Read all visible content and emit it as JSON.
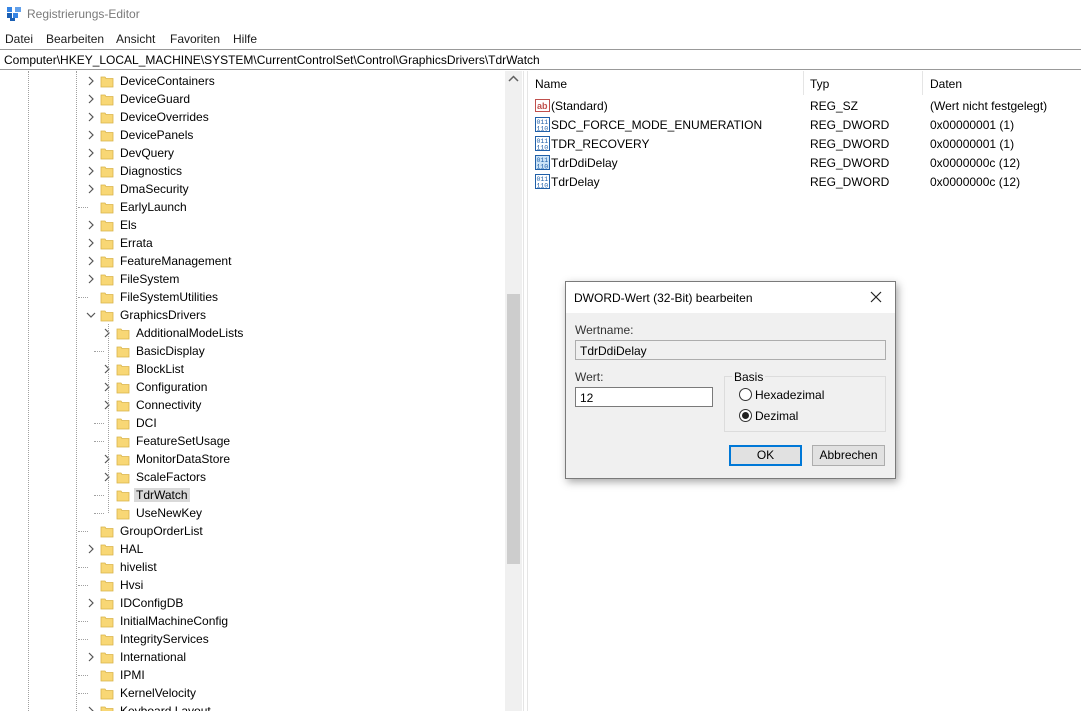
{
  "window": {
    "title": "Registrierungs-Editor"
  },
  "menu": [
    "Datei",
    "Bearbeiten",
    "Ansicht",
    "Favoriten",
    "Hilfe"
  ],
  "address": "Computer\\HKEY_LOCAL_MACHINE\\SYSTEM\\CurrentControlSet\\Control\\GraphicsDrivers\\TdrWatch",
  "tree": [
    {
      "label": "DeviceContainers",
      "level": 0,
      "expander": "collapsed"
    },
    {
      "label": "DeviceGuard",
      "level": 0,
      "expander": "collapsed"
    },
    {
      "label": "DeviceOverrides",
      "level": 0,
      "expander": "collapsed"
    },
    {
      "label": "DevicePanels",
      "level": 0,
      "expander": "collapsed"
    },
    {
      "label": "DevQuery",
      "level": 0,
      "expander": "collapsed"
    },
    {
      "label": "Diagnostics",
      "level": 0,
      "expander": "collapsed"
    },
    {
      "label": "DmaSecurity",
      "level": 0,
      "expander": "collapsed"
    },
    {
      "label": "EarlyLaunch",
      "level": 0,
      "expander": "none"
    },
    {
      "label": "Els",
      "level": 0,
      "expander": "collapsed"
    },
    {
      "label": "Errata",
      "level": 0,
      "expander": "collapsed"
    },
    {
      "label": "FeatureManagement",
      "level": 0,
      "expander": "collapsed"
    },
    {
      "label": "FileSystem",
      "level": 0,
      "expander": "collapsed"
    },
    {
      "label": "FileSystemUtilities",
      "level": 0,
      "expander": "none"
    },
    {
      "label": "GraphicsDrivers",
      "level": 0,
      "expander": "expanded"
    },
    {
      "label": "AdditionalModeLists",
      "level": 1,
      "expander": "collapsed"
    },
    {
      "label": "BasicDisplay",
      "level": 1,
      "expander": "none"
    },
    {
      "label": "BlockList",
      "level": 1,
      "expander": "collapsed"
    },
    {
      "label": "Configuration",
      "level": 1,
      "expander": "collapsed"
    },
    {
      "label": "Connectivity",
      "level": 1,
      "expander": "collapsed"
    },
    {
      "label": "DCI",
      "level": 1,
      "expander": "none"
    },
    {
      "label": "FeatureSetUsage",
      "level": 1,
      "expander": "none"
    },
    {
      "label": "MonitorDataStore",
      "level": 1,
      "expander": "collapsed"
    },
    {
      "label": "ScaleFactors",
      "level": 1,
      "expander": "collapsed"
    },
    {
      "label": "TdrWatch",
      "level": 1,
      "expander": "none",
      "selected": true
    },
    {
      "label": "UseNewKey",
      "level": 1,
      "expander": "none"
    },
    {
      "label": "GroupOrderList",
      "level": 0,
      "expander": "none"
    },
    {
      "label": "HAL",
      "level": 0,
      "expander": "collapsed"
    },
    {
      "label": "hivelist",
      "level": 0,
      "expander": "none"
    },
    {
      "label": "Hvsi",
      "level": 0,
      "expander": "none"
    },
    {
      "label": "IDConfigDB",
      "level": 0,
      "expander": "collapsed"
    },
    {
      "label": "InitialMachineConfig",
      "level": 0,
      "expander": "none"
    },
    {
      "label": "IntegrityServices",
      "level": 0,
      "expander": "none"
    },
    {
      "label": "International",
      "level": 0,
      "expander": "collapsed"
    },
    {
      "label": "IPMI",
      "level": 0,
      "expander": "none"
    },
    {
      "label": "KernelVelocity",
      "level": 0,
      "expander": "none"
    },
    {
      "label": "Keyboard Layout",
      "level": 0,
      "expander": "collapsed"
    }
  ],
  "list": {
    "columns": [
      "Name",
      "Typ",
      "Daten"
    ],
    "rows": [
      {
        "name": "(Standard)",
        "type": "REG_SZ",
        "data": "(Wert nicht festgelegt)",
        "icon": "string-value-icon"
      },
      {
        "name": "SDC_FORCE_MODE_ENUMERATION",
        "type": "REG_DWORD",
        "data": "0x00000001 (1)",
        "icon": "binary-value-icon"
      },
      {
        "name": "TDR_RECOVERY",
        "type": "REG_DWORD",
        "data": "0x00000001 (1)",
        "icon": "binary-value-icon"
      },
      {
        "name": "TdrDdiDelay",
        "type": "REG_DWORD",
        "data": "0x0000000c (12)",
        "icon": "binary-value-icon",
        "highlighted": true
      },
      {
        "name": "TdrDelay",
        "type": "REG_DWORD",
        "data": "0x0000000c (12)",
        "icon": "binary-value-icon"
      }
    ]
  },
  "dialog": {
    "title": "DWORD-Wert (32-Bit) bearbeiten",
    "name_label": "Wertname:",
    "name_value": "TdrDdiDelay",
    "value_label": "Wert:",
    "value": "12",
    "base_title": "Basis",
    "hex_label": "Hexadezimal",
    "dec_label": "Dezimal",
    "selected_base": "dec",
    "ok_label": "OK",
    "cancel_label": "Abbrechen"
  },
  "colors": {
    "selection": "#d9d9d9",
    "accent": "#0078d7",
    "folder": "#f8d775"
  }
}
